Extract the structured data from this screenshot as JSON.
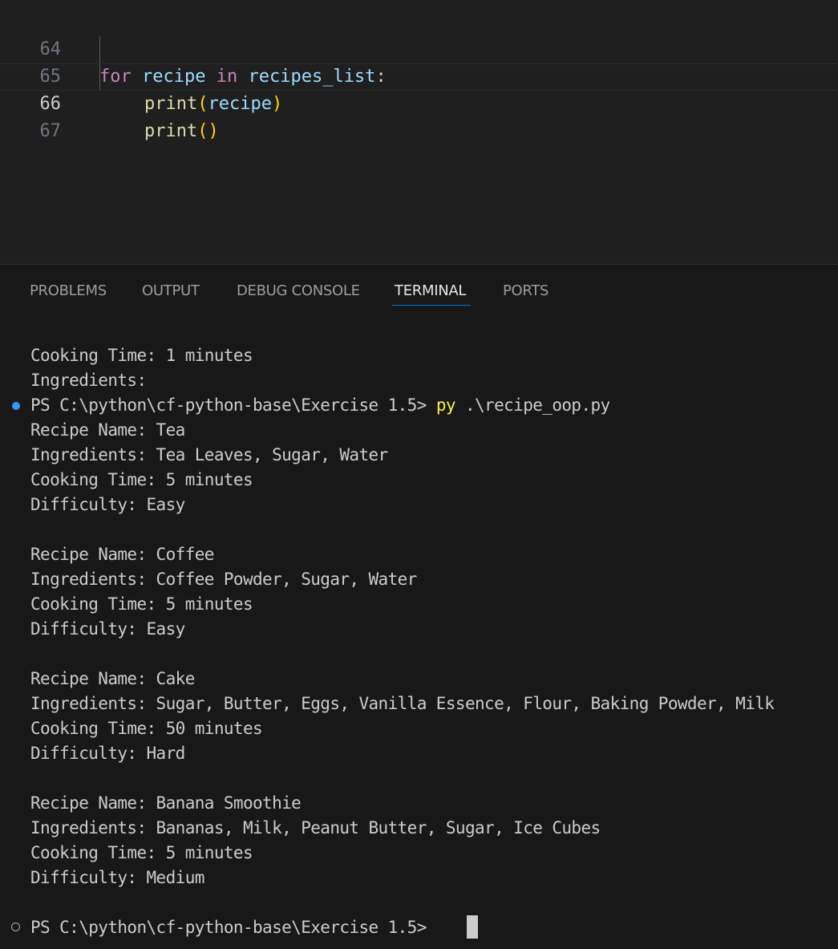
{
  "editor": {
    "lines": [
      {
        "num": "64",
        "kw1": "for",
        "var1": "recipe",
        "kw2": "in",
        "var2": "recipes_list",
        "punc": ":"
      },
      {
        "num": "65",
        "fn": "print",
        "open": "(",
        "arg": "recipe",
        "close": ")"
      },
      {
        "num": "66",
        "fn": "print",
        "open": "(",
        "close": ")"
      },
      {
        "num": "67"
      }
    ]
  },
  "panel": {
    "tabs": [
      "PROBLEMS",
      "OUTPUT",
      "DEBUG CONSOLE",
      "TERMINAL",
      "PORTS"
    ],
    "active_tab": "TERMINAL"
  },
  "terminal": {
    "lines_before": [
      "Cooking Time: 1 minutes",
      "Ingredients:"
    ],
    "prompt_prefix": "PS C:\\python\\cf-python-base\\Exercise 1.5> ",
    "command": "py",
    "command_args": " .\\recipe_oop.py",
    "output": [
      "Recipe Name: Tea",
      "Ingredients: Tea Leaves, Sugar, Water",
      "Cooking Time: 5 minutes",
      "Difficulty: Easy",
      "",
      "Recipe Name: Coffee",
      "Ingredients: Coffee Powder, Sugar, Water",
      "Cooking Time: 5 minutes",
      "Difficulty: Easy",
      "",
      "Recipe Name: Cake",
      "Ingredients: Sugar, Butter, Eggs, Vanilla Essence, Flour, Baking Powder, Milk",
      "Cooking Time: 50 minutes",
      "Difficulty: Hard",
      "",
      "Recipe Name: Banana Smoothie",
      "Ingredients: Bananas, Milk, Peanut Butter, Sugar, Ice Cubes",
      "Cooking Time: 5 minutes",
      "Difficulty: Medium"
    ],
    "final_prompt": "PS C:\\python\\cf-python-base\\Exercise 1.5> "
  },
  "colors": {
    "keyword": "#c586c0",
    "variable": "#9cdcfe",
    "function": "#dcdcaa",
    "bracket": "#ffd700",
    "command": "#f1f34a",
    "tab_accent": "#0078d4"
  }
}
